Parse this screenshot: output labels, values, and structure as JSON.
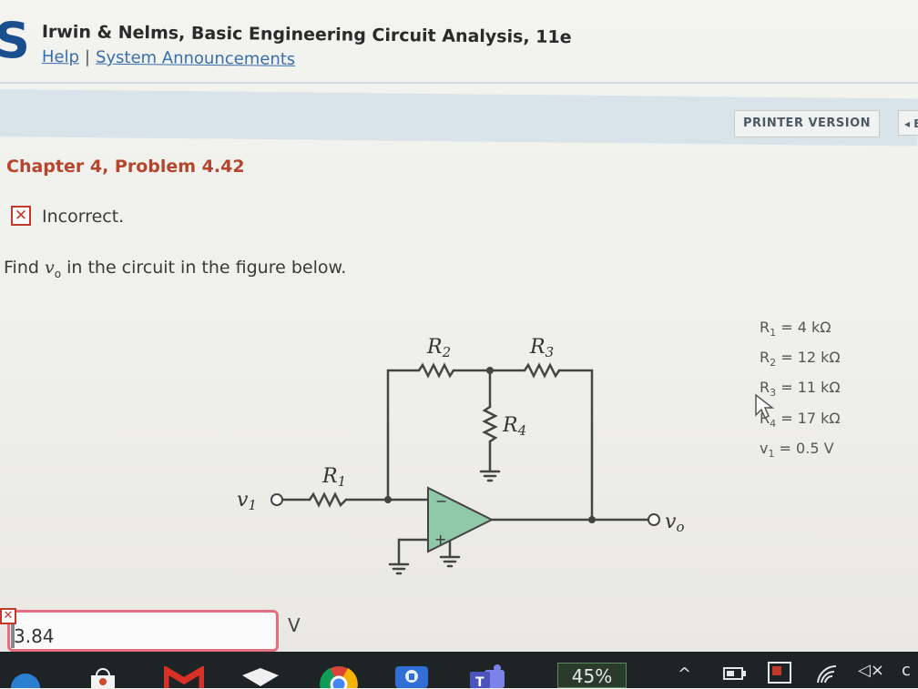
{
  "header": {
    "book_title": "Irwin & Nelms, Basic Engineering Circuit Analysis, 11e",
    "links": [
      "Help",
      "System Announcements"
    ],
    "separator": "|"
  },
  "toolbar": {
    "printer_label": "PRINTER VERSION",
    "nav_label": "◂ B"
  },
  "problem": {
    "title": "Chapter 4, Problem 4.42",
    "status_icon": "✕",
    "status": "Incorrect.",
    "question_pre": "Find ",
    "question_var": "v",
    "question_sub": "o",
    "question_post": " in the circuit in the figure below."
  },
  "circuit": {
    "labels": {
      "r1": "R",
      "r1_sub": "1",
      "r2": "R",
      "r2_sub": "2",
      "r3": "R",
      "r3_sub": "3",
      "r4": "R",
      "r4_sub": "4",
      "v1": "v",
      "v1_sub": "1",
      "vo": "v",
      "vo_sub": "o",
      "minus": "−",
      "plus": "+"
    },
    "values": [
      {
        "name": "R",
        "sub": "1",
        "value": " = 4 kΩ"
      },
      {
        "name": "R",
        "sub": "2",
        "value": " = 12 kΩ"
      },
      {
        "name": "R",
        "sub": "3",
        "value": " = 11 kΩ"
      },
      {
        "name": "R",
        "sub": "4",
        "value": " = 17 kΩ"
      },
      {
        "name": "v",
        "sub": "1",
        "value": " = 0.5 V"
      }
    ],
    "opamp_color": "#8fc9a9"
  },
  "answer": {
    "value": "3.84",
    "unit": "V",
    "error_icon": "✕"
  },
  "taskbar": {
    "battery": "45%",
    "icons": [
      "browser-icon",
      "store-icon",
      "gmail-icon",
      "mail-icon",
      "chrome-icon",
      "security-icon",
      "teams-icon"
    ],
    "tray_chevron": "^",
    "volume": "◁×"
  }
}
